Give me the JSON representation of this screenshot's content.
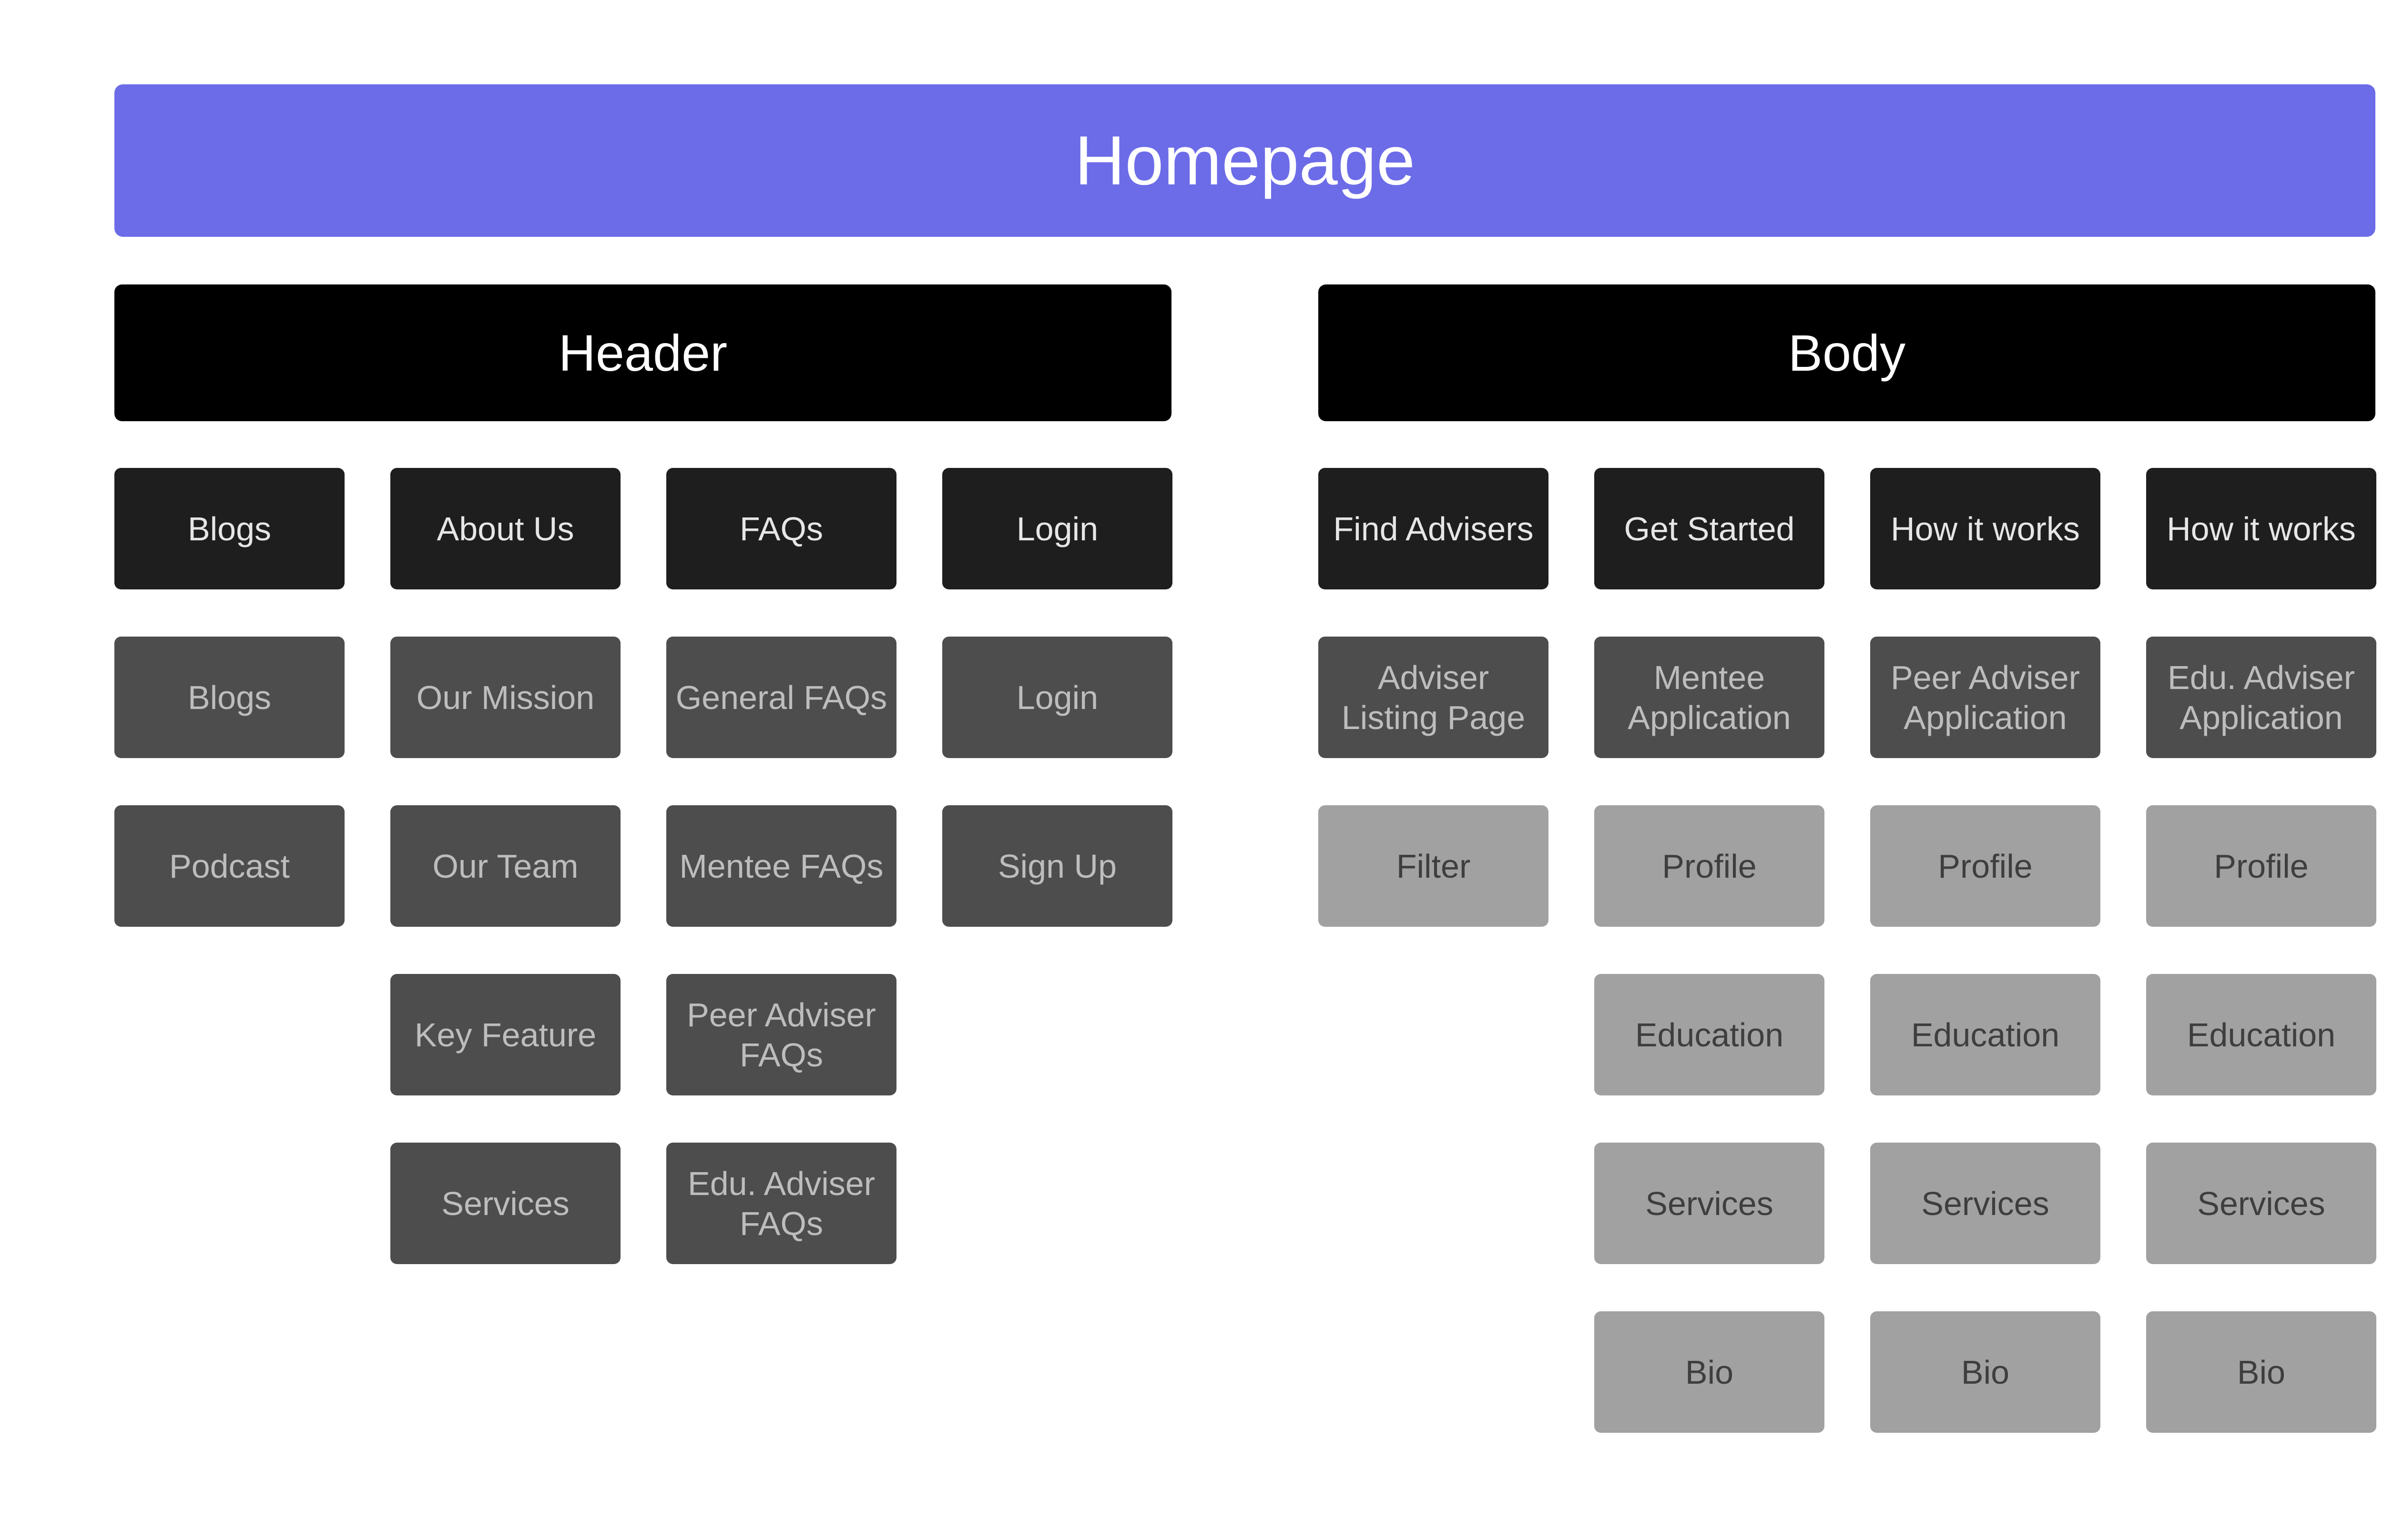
{
  "root": {
    "label": "Homepage"
  },
  "sections": [
    {
      "key": "header",
      "label": "Header",
      "columns": [
        {
          "title": "Blogs",
          "items": [
            {
              "label": "Blogs",
              "level": 2
            },
            {
              "label": "Podcast",
              "level": 2
            }
          ]
        },
        {
          "title": "About Us",
          "items": [
            {
              "label": "Our Mission",
              "level": 2
            },
            {
              "label": "Our Team",
              "level": 2
            },
            {
              "label": "Key Feature",
              "level": 2
            },
            {
              "label": "Services",
              "level": 2
            }
          ]
        },
        {
          "title": "FAQs",
          "items": [
            {
              "label": "General FAQs",
              "level": 2
            },
            {
              "label": "Mentee FAQs",
              "level": 2
            },
            {
              "label": "Peer Adviser\nFAQs",
              "level": 2
            },
            {
              "label": "Edu. Adviser\nFAQs",
              "level": 2
            }
          ]
        },
        {
          "title": "Login",
          "items": [
            {
              "label": "Login",
              "level": 2
            },
            {
              "label": "Sign Up",
              "level": 2
            }
          ]
        }
      ]
    },
    {
      "key": "body",
      "label": "Body",
      "columns": [
        {
          "title": "Find Advisers",
          "items": [
            {
              "label": "Adviser\nListing Page",
              "level": 2
            },
            {
              "label": "Filter",
              "level": 3
            }
          ]
        },
        {
          "title": "Get Started",
          "items": [
            {
              "label": "Mentee\nApplication",
              "level": 2
            },
            {
              "label": "Profile",
              "level": 3
            },
            {
              "label": "Education",
              "level": 3
            },
            {
              "label": "Services",
              "level": 3
            },
            {
              "label": "Bio",
              "level": 3
            }
          ]
        },
        {
          "title": "How it works",
          "items": [
            {
              "label": "Peer Adviser\nApplication",
              "level": 2
            },
            {
              "label": "Profile",
              "level": 3
            },
            {
              "label": "Education",
              "level": 3
            },
            {
              "label": "Services",
              "level": 3
            },
            {
              "label": "Bio",
              "level": 3
            }
          ]
        },
        {
          "title": "How it works",
          "items": [
            {
              "label": "Edu. Adviser\nApplication",
              "level": 2
            },
            {
              "label": "Profile",
              "level": 3
            },
            {
              "label": "Education",
              "level": 3
            },
            {
              "label": "Services",
              "level": 3
            },
            {
              "label": "Bio",
              "level": 3
            }
          ]
        }
      ]
    }
  ],
  "colors": {
    "root": "#6c6ce8",
    "section": "#000000",
    "level1": "#1e1e1e",
    "level2": "#4d4d4d",
    "level3": "#a1a1a1"
  }
}
